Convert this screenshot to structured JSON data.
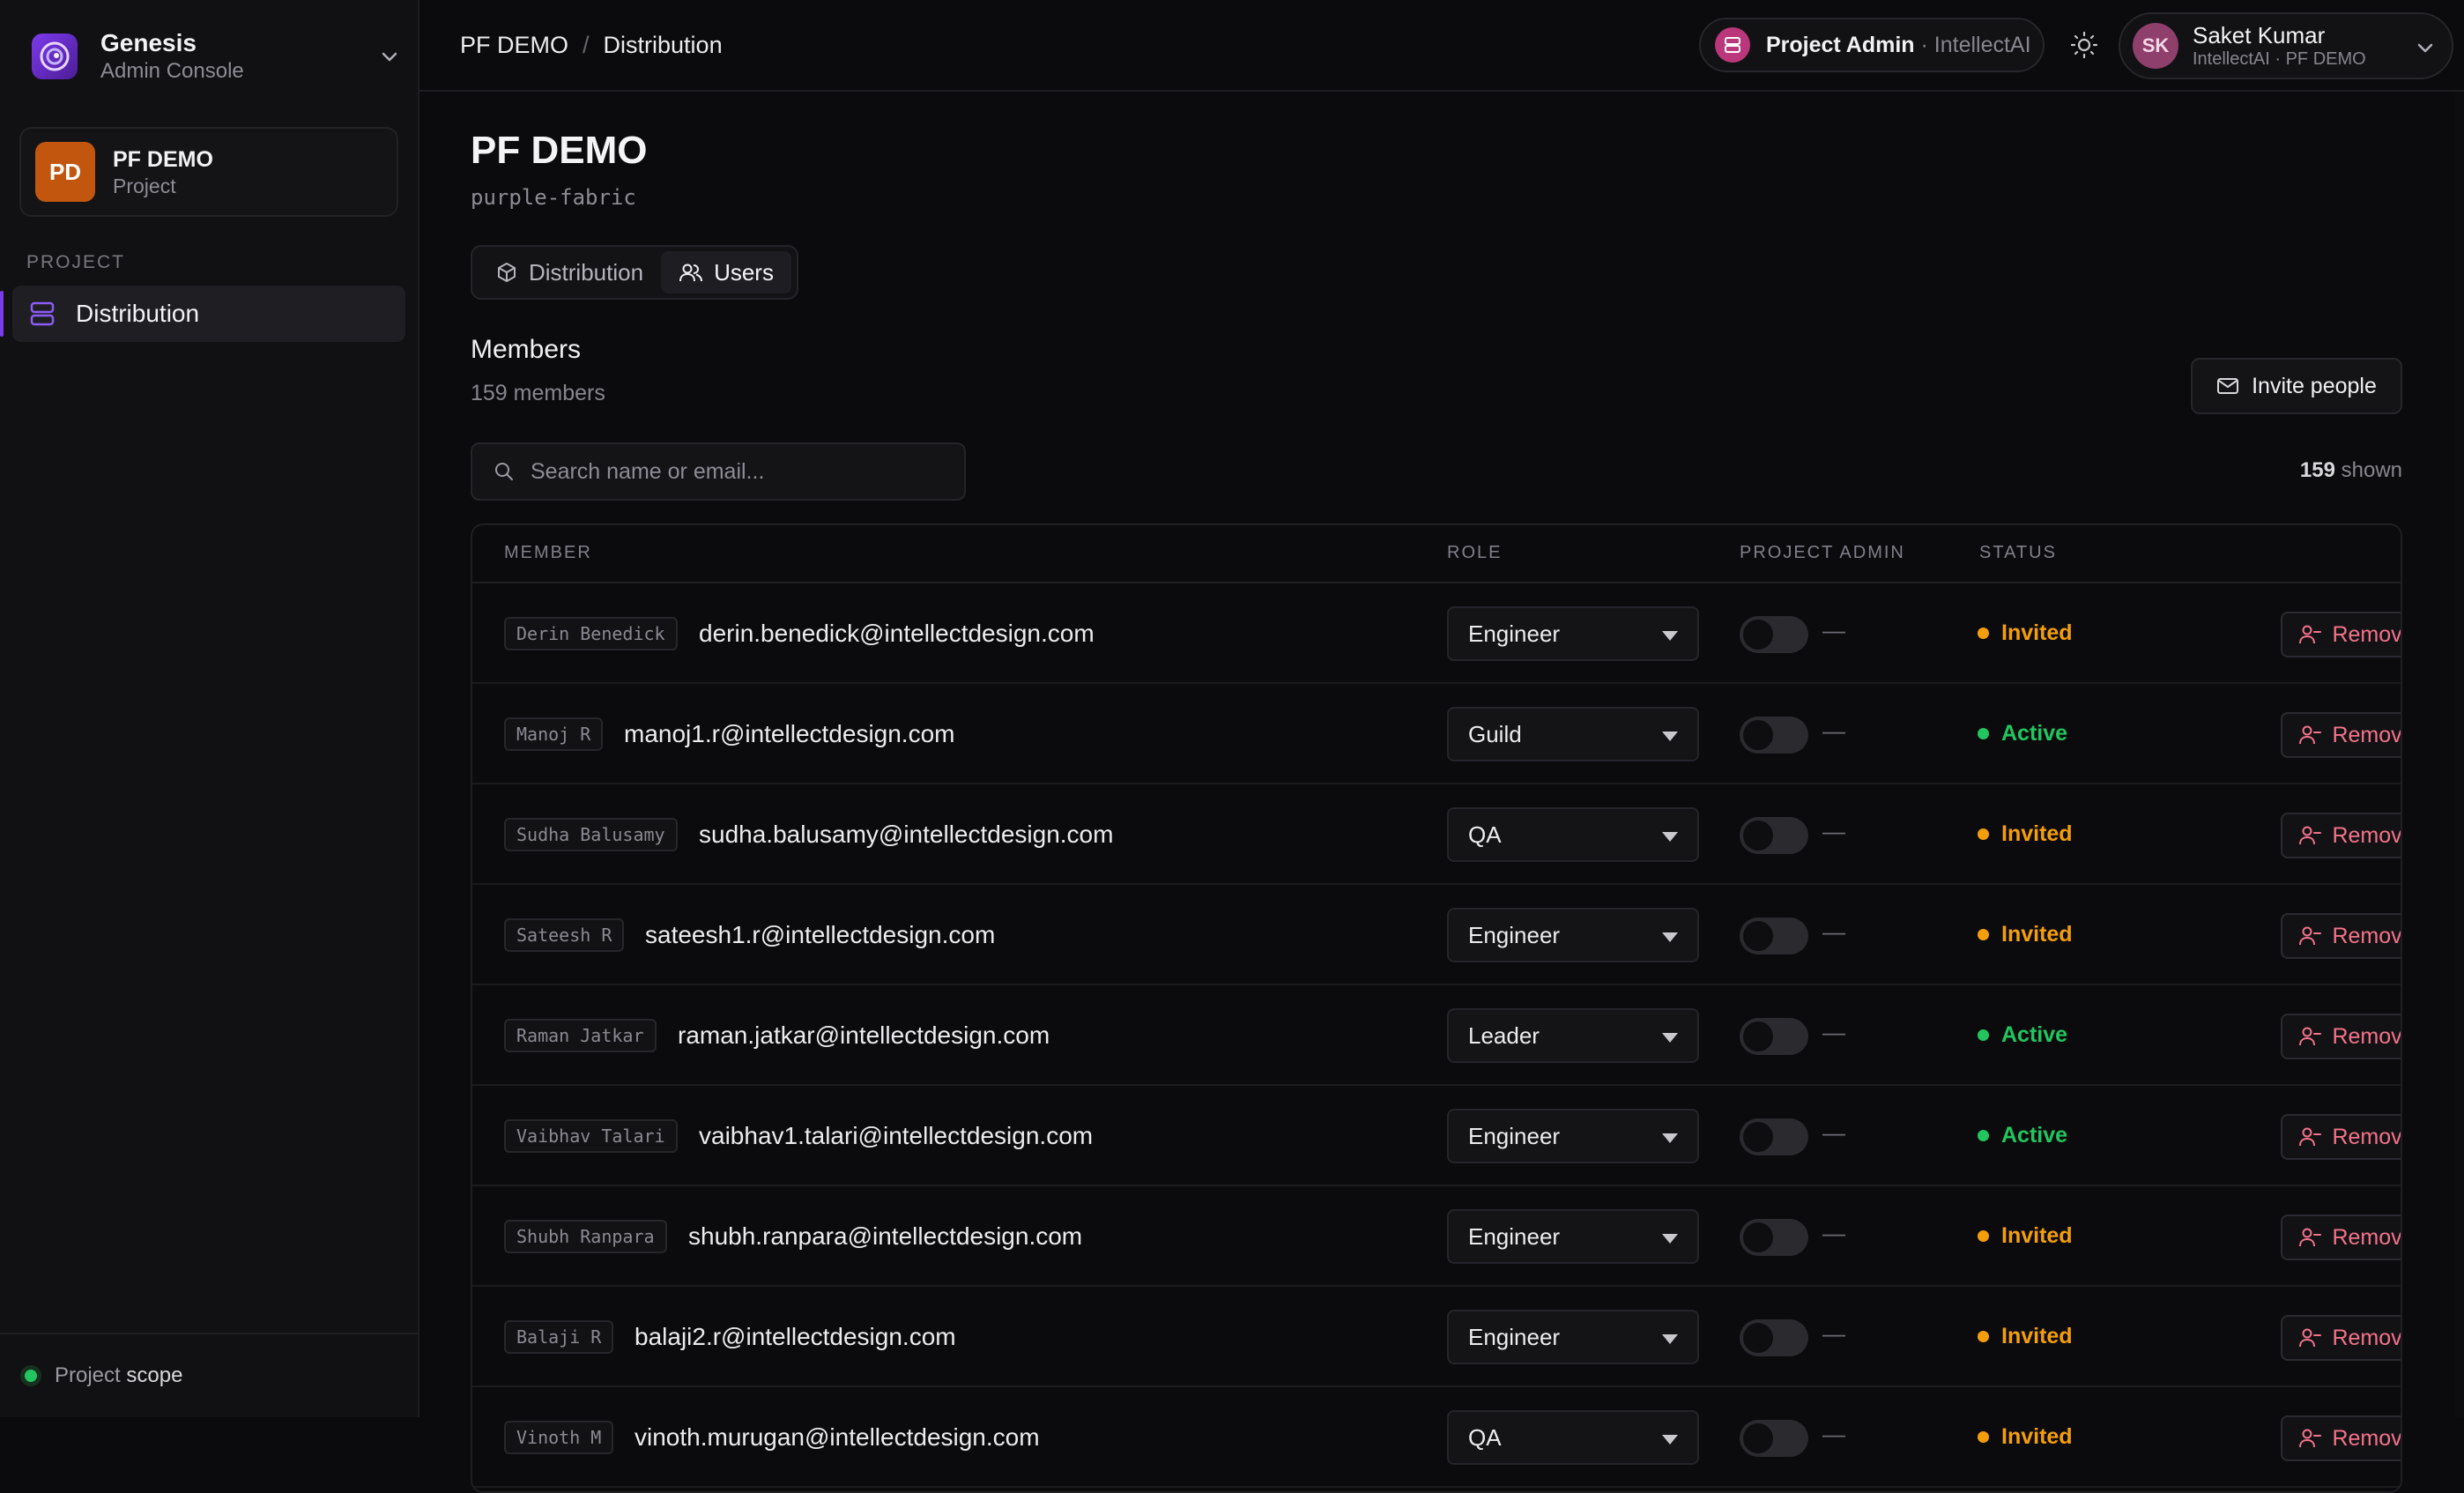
{
  "app": {
    "name": "Genesis",
    "subtitle": "Admin Console"
  },
  "sidebar": {
    "project": {
      "initials": "PD",
      "name": "PF DEMO",
      "type": "Project"
    },
    "section_label": "PROJECT",
    "items": [
      {
        "label": "Distribution",
        "active": true
      }
    ],
    "footer": {
      "prefix": "Project",
      "suffix": "scope"
    }
  },
  "header": {
    "breadcrumb": [
      "PF DEMO",
      "Distribution"
    ],
    "breadcrumb_sep": "/",
    "role": {
      "label": "Project Admin",
      "org": "· IntellectAI"
    },
    "user": {
      "initials": "SK",
      "name": "Saket Kumar",
      "org": "IntellectAI · PF DEMO"
    }
  },
  "page": {
    "title": "PF DEMO",
    "slug": "purple-fabric",
    "tabs": [
      {
        "label": "Distribution",
        "icon": "cube-icon",
        "active": false
      },
      {
        "label": "Users",
        "icon": "users-icon",
        "active": true
      }
    ],
    "members_title": "Members",
    "members_count": "159 members",
    "invite_label": "Invite people",
    "search_placeholder": "Search name or email...",
    "shown_count": "159",
    "shown_label": "shown"
  },
  "table": {
    "columns": [
      "MEMBER",
      "ROLE",
      "PROJECT ADMIN",
      "STATUS"
    ],
    "remove_label": "Remove",
    "admin_placeholder": "—",
    "rows": [
      {
        "name": "Derin Benedick",
        "email": "derin.benedick@intellectdesign.com",
        "role": "Engineer",
        "status": "Invited"
      },
      {
        "name": "Manoj R",
        "email": "manoj1.r@intellectdesign.com",
        "role": "Guild",
        "status": "Active"
      },
      {
        "name": "Sudha Balusamy",
        "email": "sudha.balusamy@intellectdesign.com",
        "role": "QA",
        "status": "Invited"
      },
      {
        "name": "Sateesh R",
        "email": "sateesh1.r@intellectdesign.com",
        "role": "Engineer",
        "status": "Invited"
      },
      {
        "name": "Raman Jatkar",
        "email": "raman.jatkar@intellectdesign.com",
        "role": "Leader",
        "status": "Active"
      },
      {
        "name": "Vaibhav Talari",
        "email": "vaibhav1.talari@intellectdesign.com",
        "role": "Engineer",
        "status": "Active"
      },
      {
        "name": "Shubh Ranpara",
        "email": "shubh.ranpara@intellectdesign.com",
        "role": "Engineer",
        "status": "Invited"
      },
      {
        "name": "Balaji R",
        "email": "balaji2.r@intellectdesign.com",
        "role": "Engineer",
        "status": "Invited"
      },
      {
        "name": "Vinoth M",
        "email": "vinoth.murugan@intellectdesign.com",
        "role": "QA",
        "status": "Invited"
      }
    ]
  },
  "colors": {
    "accent": "#7c3aed",
    "invited": "#f59e0b",
    "active": "#22c55e",
    "remove": "#f3738a"
  }
}
